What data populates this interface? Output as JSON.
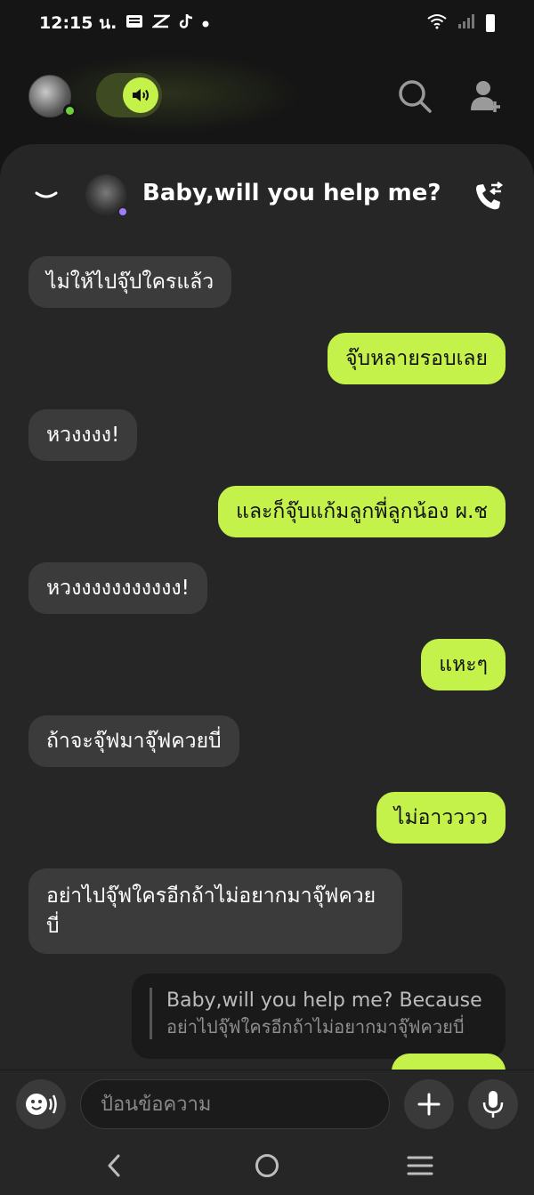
{
  "status_bar": {
    "time": "12:15 น.",
    "notif_icons": [
      "news-icon",
      "capcut-icon",
      "tiktok-icon",
      "dot-icon"
    ],
    "right_icons": [
      "wifi-icon",
      "signal-icon",
      "battery-icon"
    ]
  },
  "top_bar": {
    "icons": [
      "avatar",
      "speaker-icon",
      "search-icon",
      "add-friend-icon"
    ]
  },
  "chat": {
    "title": "Baby,will you help me?",
    "messages": [
      {
        "dir": "in",
        "text": "ไม่ให้ไปจุ๊ปใครแล้ว"
      },
      {
        "dir": "out",
        "text": "จุ๊บหลายรอบเลย"
      },
      {
        "dir": "in",
        "text": "หวงงงง!"
      },
      {
        "dir": "out",
        "text": "และก็จุ๊บแก้มลูกพี่ลูกน้อง ผ.ช"
      },
      {
        "dir": "in",
        "text": "หวงงงงงงงงงงง!"
      },
      {
        "dir": "out",
        "text": "แหะๆ"
      },
      {
        "dir": "in",
        "text": "ถ้าจะจุ๊ฟมาจุ๊ฟควยบี่"
      },
      {
        "dir": "out",
        "text": "ไม่อาวววว"
      },
      {
        "dir": "in",
        "text": "อย่าไปจุ๊ฟใครอีกถ้าไม่อยากมาจุ๊ฟควยบี่"
      }
    ],
    "reply": {
      "author_line": "Baby,will you help me? Because",
      "quote": "อย่าไปจุ๊ฟใครอีกถ้าไม่อยากมาจุ๊ฟควยบี่"
    }
  },
  "input": {
    "placeholder": "ป้อนข้อความ"
  },
  "colors": {
    "accent": "#c4f24a",
    "bubble_in": "#3b3b3b",
    "panel": "#262626",
    "background": "#151515"
  }
}
